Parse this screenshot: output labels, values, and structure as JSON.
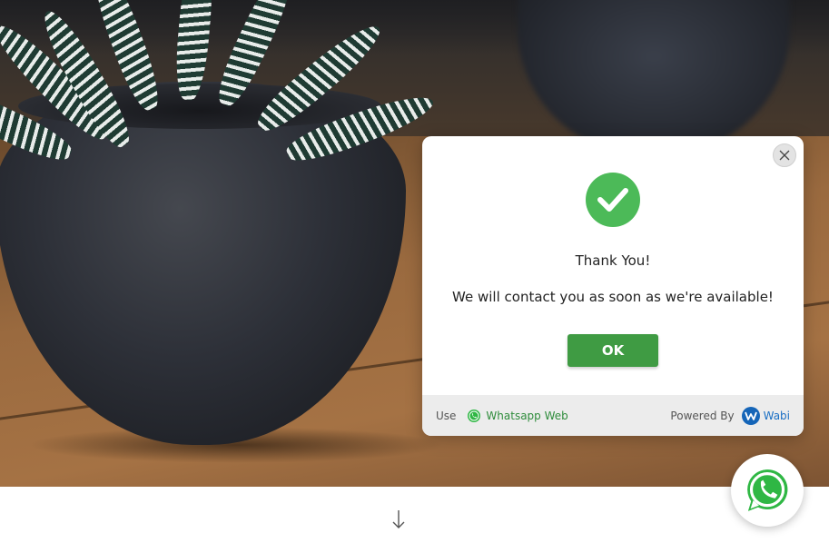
{
  "modal": {
    "close_icon": "close-icon",
    "status_icon": "checkmark-icon",
    "title": "Thank You!",
    "message": "We will contact you as soon as we're available!",
    "ok_label": "OK",
    "footer": {
      "use_label": "Use",
      "whatsapp_icon": "whatsapp-icon",
      "whatsapp_web_label": "Whatsapp Web",
      "powered_by_label": "Powered By",
      "wabi_icon": "wabi-logo-icon",
      "wabi_label": "Wabi"
    }
  },
  "floating_button": {
    "icon": "whatsapp-icon"
  },
  "scroll_hint": {
    "icon": "arrow-down-icon"
  },
  "colors": {
    "success_green": "#4cba58",
    "ok_button": "#3f9b43",
    "whatsapp_green": "#2e8c3b",
    "wabi_blue": "#1565b8",
    "footer_bg": "#ececec"
  }
}
